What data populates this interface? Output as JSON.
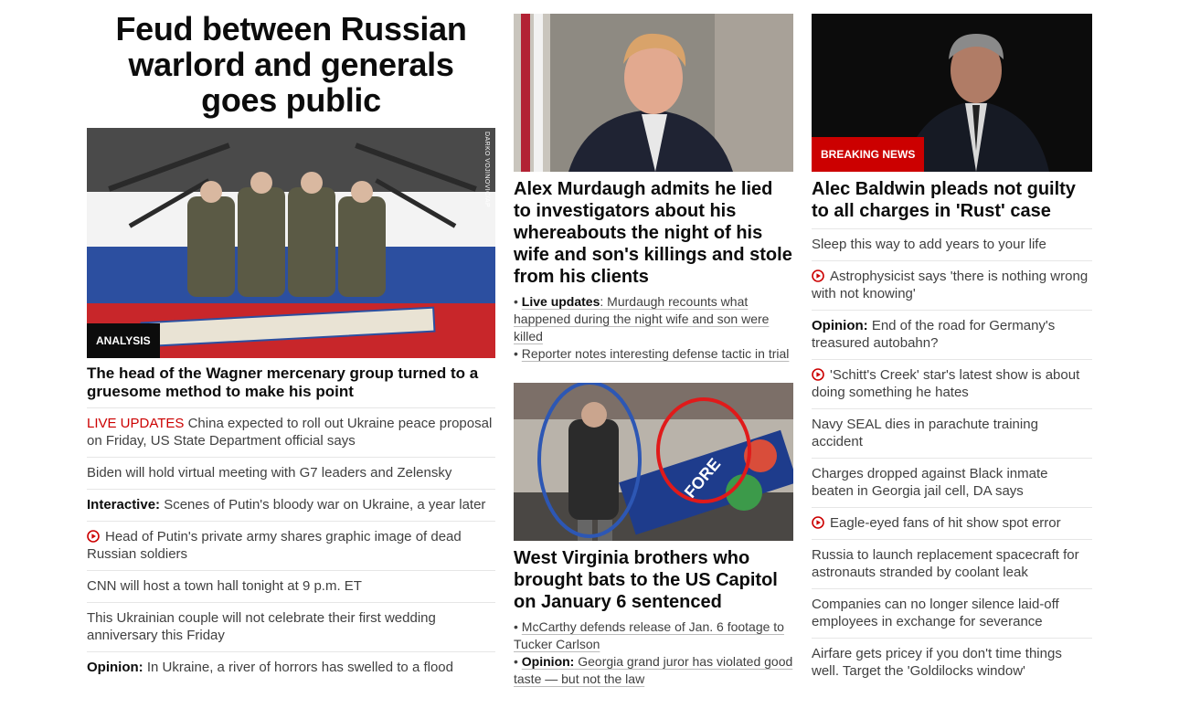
{
  "lead": {
    "headline": "Feud between Russian warlord and generals goes public",
    "image_credit": "DARKO VOJINOVIC/AP",
    "image_label": "ANALYSIS",
    "story_title": "The head of the Wagner mercenary group turned to a gruesome method to make his point",
    "related": [
      {
        "prefix": "LIVE UPDATES",
        "text": " China expected to roll out Ukraine peace proposal on Friday, US State Department official says"
      },
      {
        "text": "Biden will hold virtual meeting with G7 leaders and Zelensky"
      },
      {
        "prefix": "Interactive:",
        "text": " Scenes of Putin's bloody war on Ukraine, a year later"
      },
      {
        "icon": "play-icon",
        "text": "Head of Putin's private army shares graphic image of dead Russian soldiers"
      },
      {
        "text": "CNN will host a town hall tonight at 9 p.m. ET"
      },
      {
        "text": "This Ukrainian couple will not celebrate their first wedding anniversary this Friday"
      },
      {
        "prefix": "Opinion:",
        "text": " In Ukraine, a river of horrors has swelled to a flood"
      }
    ]
  },
  "murdaugh": {
    "title": "Alex Murdaugh admits he lied to investigators about his whereabouts the night of his wife and son's killings and stole from his clients",
    "bullets": [
      {
        "bold": "Live updates",
        "text": ": Murdaugh recounts what happened during the night wife and son were killed"
      },
      {
        "text": "Reporter notes interesting defense tactic in trial"
      }
    ]
  },
  "capitol": {
    "title": "West Virginia brothers who brought bats to the US Capitol on January 6 sentenced",
    "sign_text": "FORE",
    "bullets": [
      {
        "text": "McCarthy defends release of Jan. 6 footage to Tucker Carlson"
      },
      {
        "bold": "Opinion:",
        "text": " Georgia grand juror has violated good taste — but not the law"
      }
    ]
  },
  "baldwin": {
    "image_label": "BREAKING NEWS",
    "title": "Alec Baldwin pleads not guilty to all charges in 'Rust' case",
    "related": [
      {
        "text": "Sleep this way to add years to your life"
      },
      {
        "icon": "play-icon",
        "text": "Astrophysicist says 'there is nothing wrong with not knowing'"
      },
      {
        "prefix": "Opinion:",
        "text": " End of the road for Germany's treasured autobahn?"
      },
      {
        "icon": "play-icon",
        "text": "'Schitt's Creek' star's latest show is about doing something he hates"
      },
      {
        "text": "Navy SEAL dies in parachute training accident"
      },
      {
        "text": "Charges dropped against Black inmate beaten in Georgia jail cell, DA says"
      },
      {
        "icon": "play-icon",
        "text": "Eagle-eyed fans of hit show spot error"
      },
      {
        "text": "Russia to launch replacement spacecraft for astronauts stranded by coolant leak"
      },
      {
        "text": "Companies can no longer silence laid-off employees in exchange for severance"
      },
      {
        "text": "Airfare gets pricey if you don't time things well. Target the 'Goldilocks window'"
      }
    ]
  },
  "colors": {
    "brand_red": "#cc0000",
    "text": "#0c0c0c",
    "divider": "#e6e6e6"
  }
}
